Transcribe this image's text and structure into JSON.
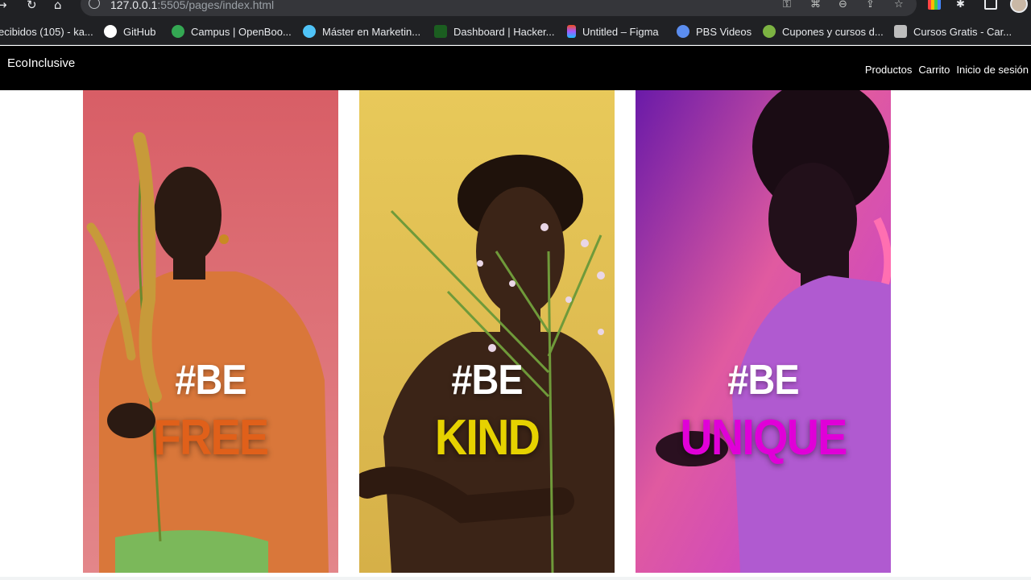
{
  "browser": {
    "url_host": "127.0.0.1",
    "url_rest": ":5505/pages/index.html",
    "bookmarks": [
      {
        "label": "ecibidos (105) - ka...",
        "color": "#ea4335"
      },
      {
        "label": "GitHub",
        "color": "#ffffff"
      },
      {
        "label": "Campus | OpenBoo...",
        "color": "#34a853"
      },
      {
        "label": "Máster en Marketin...",
        "color": "#4fc3f7"
      },
      {
        "label": "Dashboard | Hacker...",
        "color": "#2e7d32"
      },
      {
        "label": "Untitled – Figma",
        "color": "#f24e1e"
      },
      {
        "label": "PBS Videos",
        "color": "#5b8def"
      },
      {
        "label": "Cupones y cursos d...",
        "color": "#7cb342"
      },
      {
        "label": "Cursos Gratis - Car...",
        "color": "#9e9e9e"
      }
    ]
  },
  "site": {
    "brand": "EcoInclusive",
    "nav": [
      "Productos",
      "Carrito",
      "Inicio de sesión"
    ]
  },
  "panels": [
    {
      "hashtag": "#BE",
      "word": "FREE",
      "word_color": "#e0601a",
      "bg_top": "#d9646b",
      "bg_bottom": "#e07f82",
      "shirt": "#d9773a",
      "accent": "#7bb85a",
      "plant": "#c79a3a"
    },
    {
      "hashtag": "#BE",
      "word": "KIND",
      "word_color": "#e6d200",
      "bg_top": "#e8c95a",
      "bg_bottom": "#d8b44a",
      "shirt": "#3b2417",
      "accent": "#6f9a3a",
      "plant": "#8fb35a"
    },
    {
      "hashtag": "#BE",
      "word": "UNIQUE",
      "word_color": "#e000d8",
      "bg_top": "#7a1fb0",
      "bg_bottom": "#e04aa8",
      "shirt": "#b05ad0",
      "accent": "#ff6fb1",
      "plant": "#2a1020"
    }
  ]
}
